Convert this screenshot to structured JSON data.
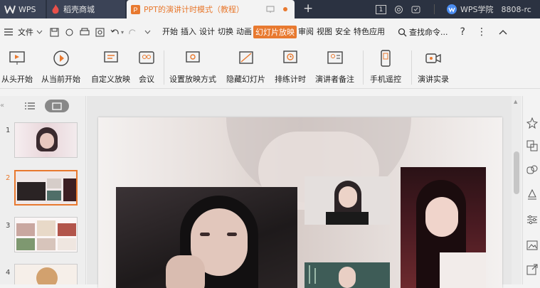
{
  "titlebar": {
    "wps_tab": "WPS",
    "dk_tab": "稻壳商城",
    "doc_tab": "PPT的演讲计时模式（教程）",
    "new_tab": "+",
    "badge": "1",
    "account": "WPS学院",
    "account_id": "8808-rc"
  },
  "menubar": {
    "file": "文件",
    "items": [
      "开始",
      "插入",
      "设计",
      "切换",
      "动画",
      "幻灯片放映",
      "审阅",
      "视图",
      "安全",
      "特色应用"
    ],
    "search": "查找命令..."
  },
  "ribbon": {
    "buttons": [
      "从头开始",
      "从当前开始",
      "自定义放映",
      "会议",
      "设置放映方式",
      "隐藏幻灯片",
      "排练计时",
      "演讲者备注",
      "手机遥控",
      "演讲实录"
    ]
  },
  "slides": {
    "numbers": [
      "1",
      "2",
      "3",
      "4"
    ]
  },
  "colors": {
    "accent": "#e8792f",
    "titlebar": "#2b3241"
  }
}
